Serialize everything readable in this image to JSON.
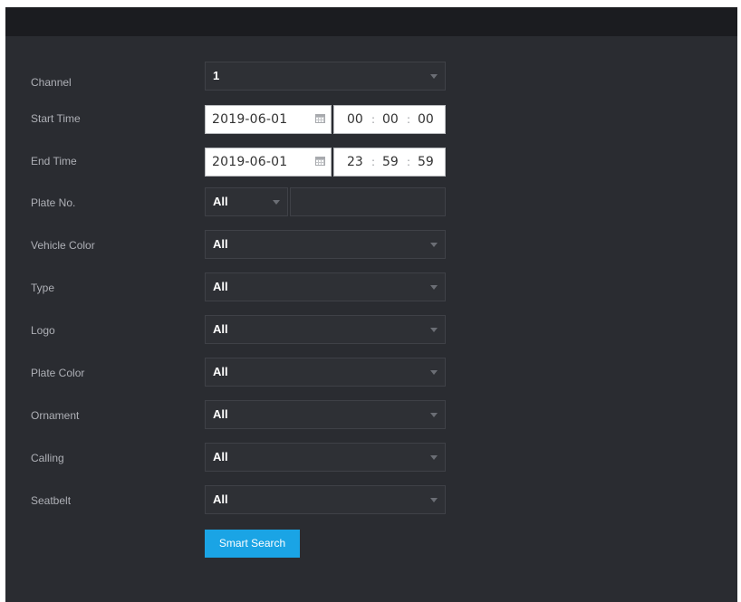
{
  "form": {
    "channel": {
      "label": "Channel",
      "value": "1"
    },
    "start_time": {
      "label": "Start Time",
      "date": "2019-06-01",
      "hh": "00",
      "mm": "00",
      "ss": "00"
    },
    "end_time": {
      "label": "End Time",
      "date": "2019-06-01",
      "hh": "23",
      "mm": "59",
      "ss": "59"
    },
    "plate_no": {
      "label": "Plate No.",
      "value": "All",
      "text": ""
    },
    "vehicle_color": {
      "label": "Vehicle Color",
      "value": "All"
    },
    "type": {
      "label": "Type",
      "value": "All"
    },
    "logo": {
      "label": "Logo",
      "value": "All"
    },
    "plate_color": {
      "label": "Plate Color",
      "value": "All"
    },
    "ornament": {
      "label": "Ornament",
      "value": "All"
    },
    "calling": {
      "label": "Calling",
      "value": "All"
    },
    "seatbelt": {
      "label": "Seatbelt",
      "value": "All"
    },
    "time_separator": ":"
  },
  "buttons": {
    "smart_search": "Smart Search"
  },
  "icons": {
    "calendar": "calendar-icon",
    "dropdown": "chevron-down-icon"
  },
  "colors": {
    "panel_bg": "#2a2c31",
    "title_bar": "#1b1c20",
    "accent": "#1aa4e5"
  }
}
